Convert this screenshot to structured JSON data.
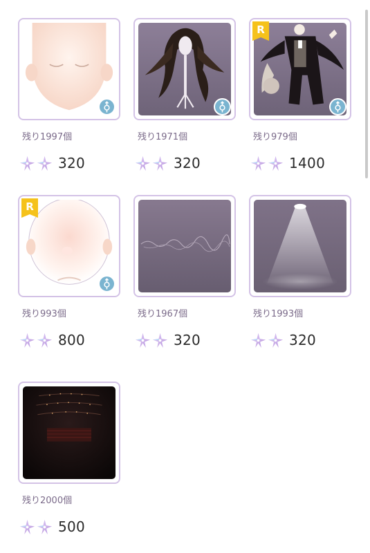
{
  "items": [
    {
      "remaining": "残り1997個",
      "price": "320",
      "rare_badge": "",
      "art": "face-base",
      "unisex": true
    },
    {
      "remaining": "残り1971個",
      "price": "320",
      "rare_badge": "",
      "art": "long-dark-hair",
      "unisex": true
    },
    {
      "remaining": "残り979個",
      "price": "1400",
      "rare_badge": "R",
      "art": "tuxedo-outfit",
      "unisex": true
    },
    {
      "remaining": "残り993個",
      "price": "800",
      "rare_badge": "R",
      "art": "round-face",
      "unisex": true
    },
    {
      "remaining": "残り1967個",
      "price": "320",
      "rare_badge": "",
      "art": "script-text-background",
      "unisex": false
    },
    {
      "remaining": "残り1993個",
      "price": "320",
      "rare_badge": "",
      "art": "spotlight-background",
      "unisex": false
    },
    {
      "remaining": "残り2000個",
      "price": "500",
      "rare_badge": "",
      "art": "theater-hall-background",
      "unisex": false
    }
  ],
  "currency_icon": "crystal-flower-icon",
  "gender_icon": "unisex-gender-icon",
  "colors": {
    "card_border": "#d3c2e6",
    "badge_rare": "#f5c21b",
    "gender_badge": "#7ab4d0",
    "remaining_text": "#7b6b8a",
    "price_text": "#2a2a2a"
  }
}
